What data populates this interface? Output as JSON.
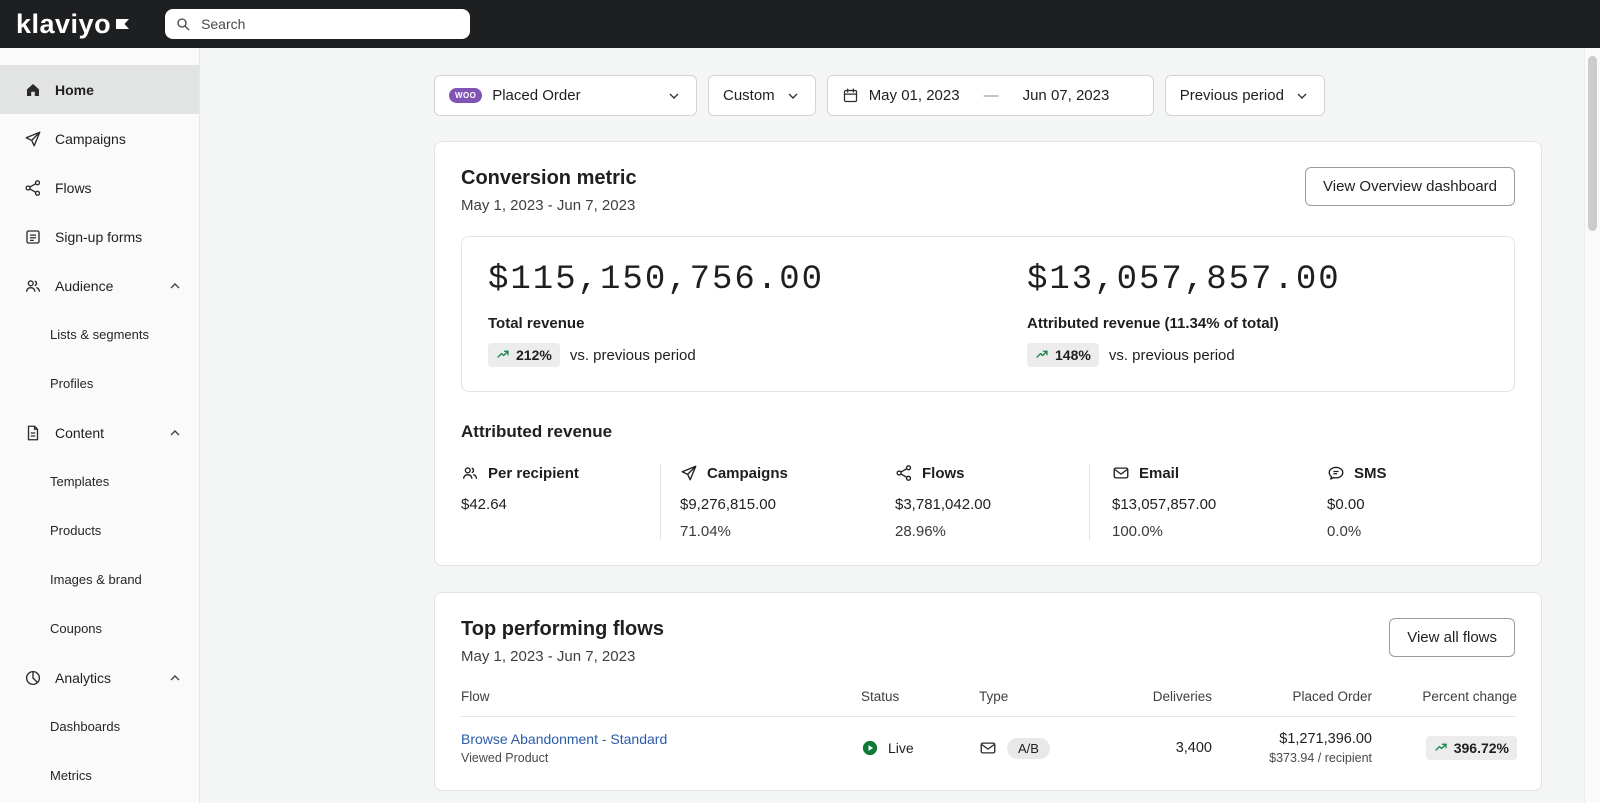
{
  "topbar": {
    "logo_text": "klaviyo",
    "search_placeholder": "Search"
  },
  "sidebar": {
    "items": [
      {
        "label": "Home",
        "icon": "home-icon",
        "active": true
      },
      {
        "label": "Campaigns",
        "icon": "send-icon"
      },
      {
        "label": "Flows",
        "icon": "flows-icon"
      },
      {
        "label": "Sign-up forms",
        "icon": "form-icon"
      },
      {
        "label": "Audience",
        "icon": "people-icon",
        "expanded": true
      },
      {
        "label": "Lists & segments",
        "child": true
      },
      {
        "label": "Profiles",
        "child": true
      },
      {
        "label": "Content",
        "icon": "document-icon",
        "expanded": true
      },
      {
        "label": "Templates",
        "child": true
      },
      {
        "label": "Products",
        "child": true
      },
      {
        "label": "Images & brand",
        "child": true
      },
      {
        "label": "Coupons",
        "child": true
      },
      {
        "label": "Analytics",
        "icon": "pie-icon",
        "expanded": true
      },
      {
        "label": "Dashboards",
        "child": true
      },
      {
        "label": "Metrics",
        "child": true
      }
    ]
  },
  "filters": {
    "metric_label": "Placed Order",
    "metric_badge": "WOO",
    "range_type": "Custom",
    "date_start": "May 01, 2023",
    "date_separator": "—",
    "date_end": "Jun 07, 2023",
    "compare_label": "Previous period"
  },
  "conversion_card": {
    "title": "Conversion metric",
    "subtitle": "May 1, 2023 - Jun 7, 2023",
    "button": "View Overview dashboard",
    "total": {
      "value": "$115,150,756.00",
      "label": "Total revenue",
      "change": "212%",
      "change_suffix": "vs. previous period"
    },
    "attributed": {
      "value": "$13,057,857.00",
      "label": "Attributed revenue (11.34% of total)",
      "change": "148%",
      "change_suffix": "vs. previous period"
    },
    "breakdown_title": "Attributed revenue",
    "breakdown": [
      {
        "label": "Per recipient",
        "icon": "people-icon",
        "value": "$42.64",
        "percent": ""
      },
      {
        "label": "Campaigns",
        "icon": "send-icon",
        "value": "$9,276,815.00",
        "percent": "71.04%"
      },
      {
        "label": "Flows",
        "icon": "flows-icon",
        "value": "$3,781,042.00",
        "percent": "28.96%"
      },
      {
        "label": "Email",
        "icon": "email-icon",
        "value": "$13,057,857.00",
        "percent": "100.0%"
      },
      {
        "label": "SMS",
        "icon": "sms-icon",
        "value": "$0.00",
        "percent": "0.0%"
      }
    ]
  },
  "flows_card": {
    "title": "Top performing flows",
    "subtitle": "May 1, 2023 - Jun 7, 2023",
    "button": "View all flows",
    "columns": [
      "Flow",
      "Status",
      "Type",
      "Deliveries",
      "Placed Order",
      "Percent change"
    ],
    "rows": [
      {
        "name": "Browse Abandonment - Standard",
        "trigger": "Viewed Product",
        "status": "Live",
        "type_badge": "A/B",
        "deliveries": "3,400",
        "placed_order": "$1,271,396.00",
        "per_recipient": "$373.94 / recipient",
        "percent_change": "396.72%"
      }
    ]
  }
}
